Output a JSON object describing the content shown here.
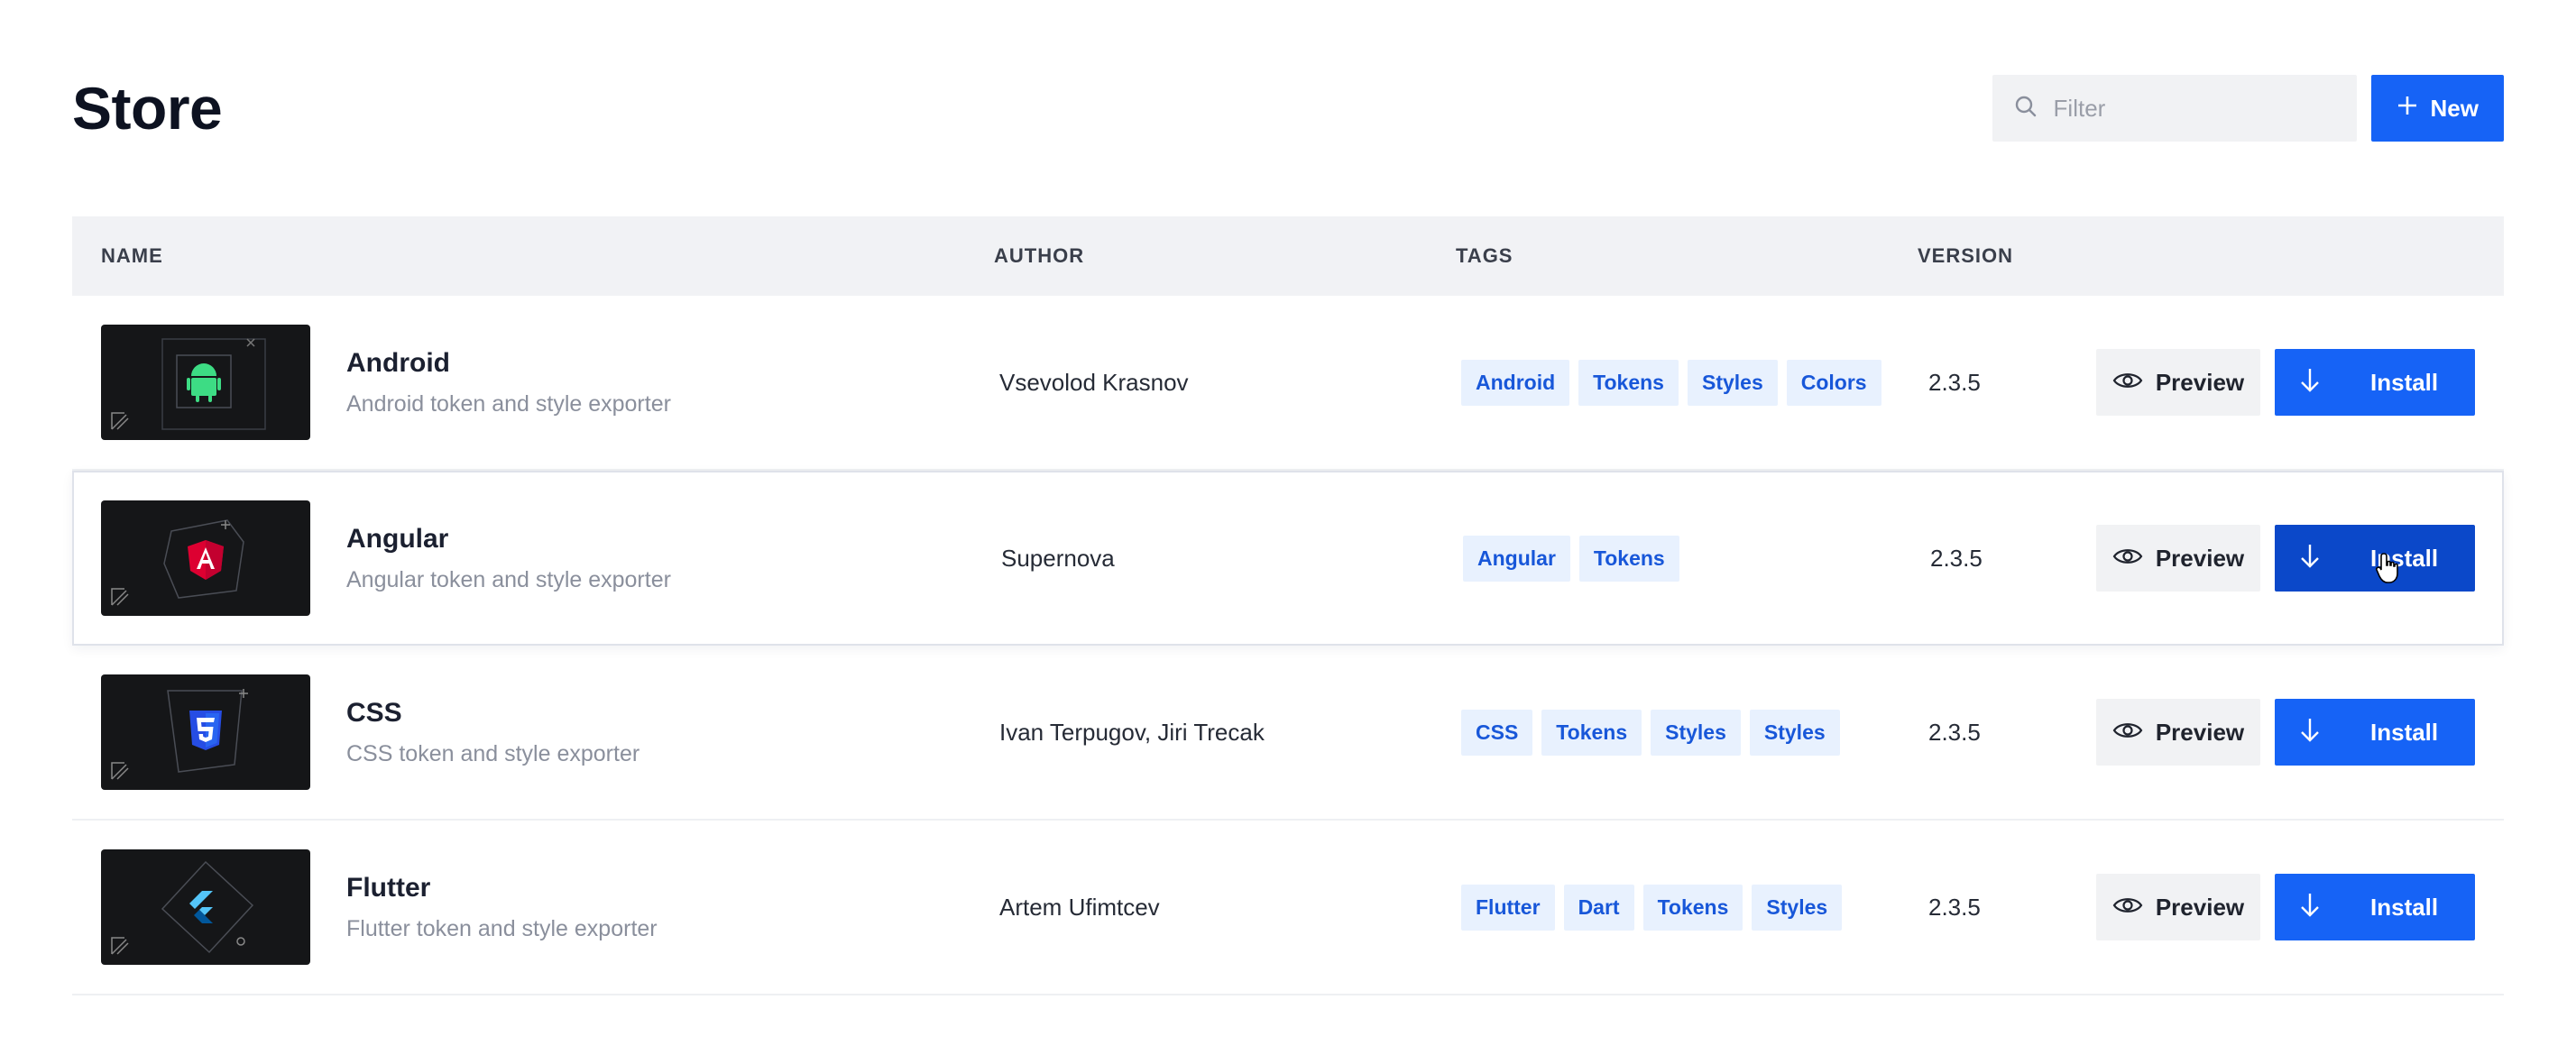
{
  "header": {
    "title": "Store",
    "filter_placeholder": "Filter",
    "new_label": "New"
  },
  "table": {
    "columns": [
      "NAME",
      "AUTHOR",
      "TAGS",
      "VERSION"
    ],
    "rows": [
      {
        "name": "Android",
        "description": "Android token and style exporter",
        "author": "Vsevolod Krasnov",
        "tags": [
          "Android",
          "Tokens",
          "Styles",
          "Colors"
        ],
        "version": "2.3.5",
        "preview_label": "Preview",
        "install_label": "Install",
        "thumb_icon": "android-logo-icon"
      },
      {
        "name": "Angular",
        "description": "Angular token and style exporter",
        "author": "Supernova",
        "tags": [
          "Angular",
          "Tokens"
        ],
        "version": "2.3.5",
        "preview_label": "Preview",
        "install_label": "Install",
        "thumb_icon": "angular-logo-icon"
      },
      {
        "name": "CSS",
        "description": "CSS token and style exporter",
        "author": "Ivan Terpugov, Jiri Trecak",
        "tags": [
          "CSS",
          "Tokens",
          "Styles",
          "Styles"
        ],
        "version": "2.3.5",
        "preview_label": "Preview",
        "install_label": "Install",
        "thumb_icon": "css3-logo-icon"
      },
      {
        "name": "Flutter",
        "description": "Flutter token and style exporter",
        "author": "Artem Ufimtcev",
        "tags": [
          "Flutter",
          "Dart",
          "Tokens",
          "Styles"
        ],
        "version": "2.3.5",
        "preview_label": "Preview",
        "install_label": "Install",
        "thumb_icon": "flutter-logo-icon"
      }
    ]
  },
  "colors": {
    "primary": "#1663f6",
    "primary_pressed": "#0b48c9",
    "tag_bg": "#e8f1fe",
    "tag_text": "#1857d9"
  }
}
